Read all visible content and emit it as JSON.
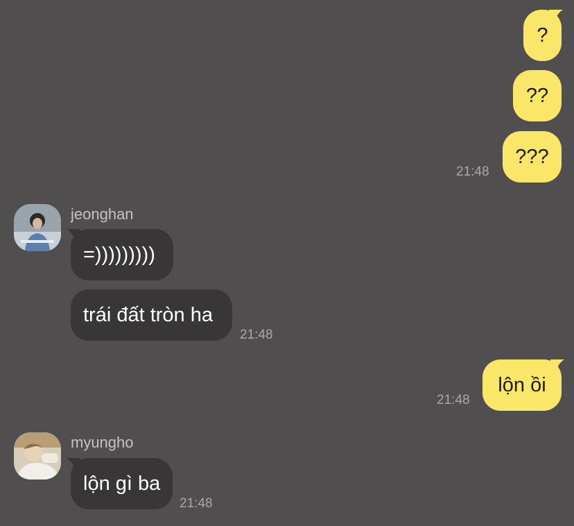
{
  "messages": [
    {
      "sender": "me",
      "text": "?"
    },
    {
      "sender": "me",
      "text": "??"
    },
    {
      "sender": "me",
      "text": "???",
      "time": "21:48"
    },
    {
      "sender": "jeonghan",
      "text": "=)))))))))"
    },
    {
      "sender": "jeonghan",
      "text": "trái đất tròn ha",
      "time": "21:48"
    },
    {
      "sender": "me",
      "text": "lộn ồi",
      "time": "21:48"
    },
    {
      "sender": "myungho",
      "text": "lộn gì ba",
      "time": "21:48"
    }
  ],
  "contacts": {
    "jeonghan": {
      "name": "jeonghan"
    },
    "myungho": {
      "name": "myungho"
    }
  },
  "colors": {
    "background": "#504e4f",
    "outgoing_bubble": "#fae769",
    "incoming_bubble": "#383637",
    "timestamp": "#a9a7a8"
  }
}
